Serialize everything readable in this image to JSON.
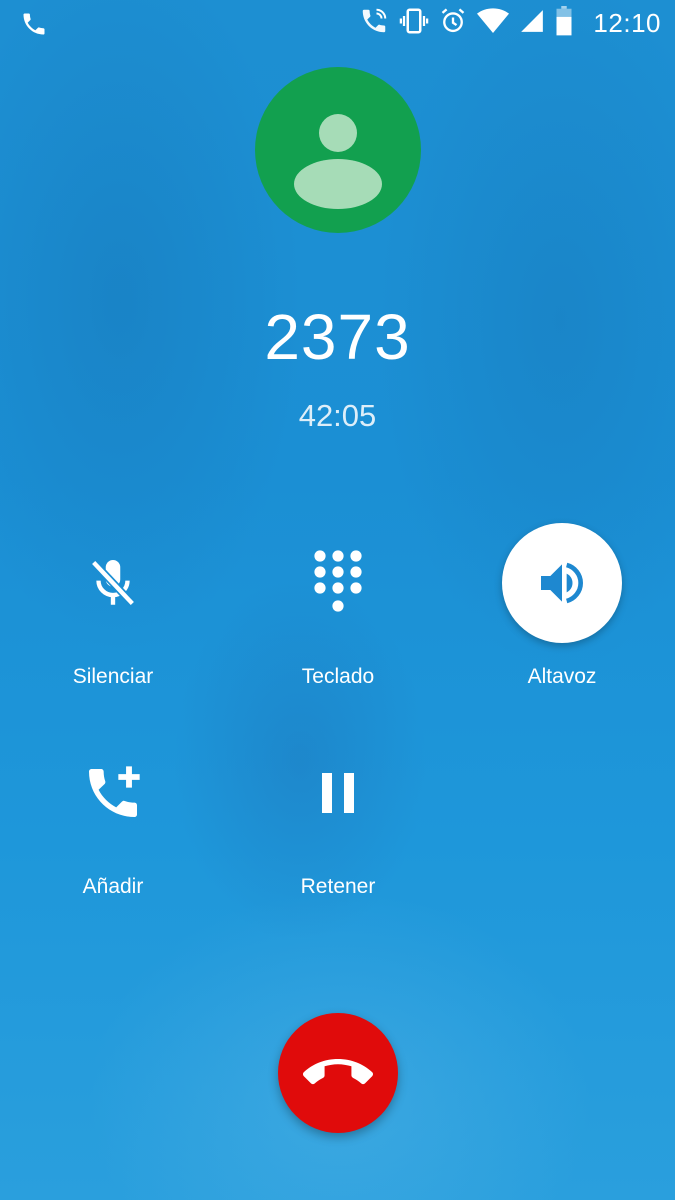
{
  "status_bar": {
    "time": "12:10",
    "icons": [
      "phone-icon",
      "wifi-call-icon",
      "vibrate-icon",
      "alarm-icon",
      "wifi-icon",
      "signal-icon",
      "battery-icon"
    ]
  },
  "call": {
    "caller": "2373",
    "duration": "42:05"
  },
  "controls": [
    {
      "label": "Silenciar",
      "icon": "mic-off-icon",
      "active": false
    },
    {
      "label": "Teclado",
      "icon": "dialpad-icon",
      "active": false
    },
    {
      "label": "Altavoz",
      "icon": "speaker-icon",
      "active": true
    },
    {
      "label": "Añadir",
      "icon": "add-call-icon",
      "active": false
    },
    {
      "label": "Retener",
      "icon": "pause-icon",
      "active": false
    }
  ],
  "colors": {
    "background": "#1b8fd4",
    "avatar": "#12a04f",
    "end_call": "#e00b0b",
    "active_icon": "#1e88d0"
  }
}
